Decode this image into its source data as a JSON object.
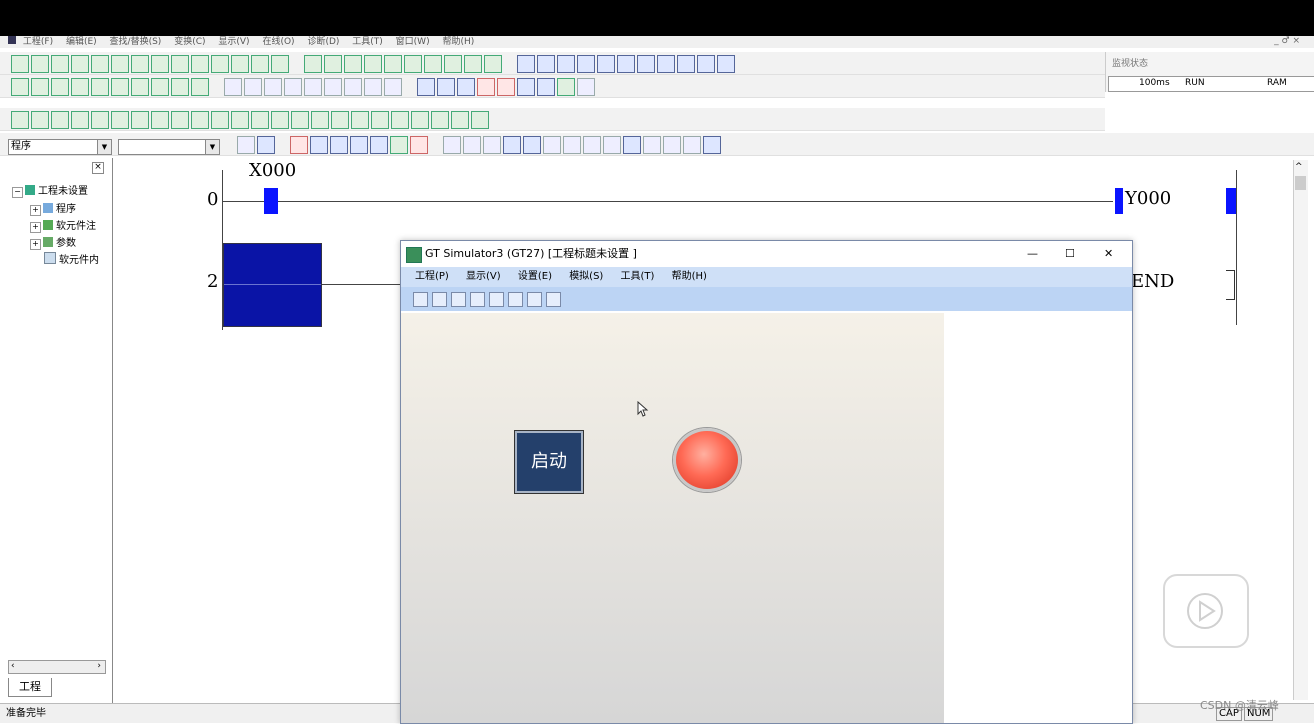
{
  "menubar": {
    "items": [
      "工程(F)",
      "编辑(E)",
      "查找/替换(S)",
      "变换(C)",
      "显示(V)",
      "在线(O)",
      "诊断(D)",
      "工具(T)",
      "窗口(W)",
      "帮助(H)"
    ],
    "window_controls": "_ ♂ ×"
  },
  "monitor": {
    "title": "监视状态",
    "scan_time": "100ms",
    "mode": "RUN",
    "memory": "RAM"
  },
  "toolbar": {
    "program_combo": "程序"
  },
  "tree": {
    "root": "工程未设置",
    "items": [
      "程序",
      "软元件注",
      "参数",
      "软元件内"
    ],
    "tab": "工程"
  },
  "ladder": {
    "step0": "0",
    "step2": "2",
    "contact": "X000",
    "coil": "Y000",
    "end": "END"
  },
  "status": {
    "left": "准备完毕",
    "cap": "CAP",
    "num": "NUM"
  },
  "simulator": {
    "title": "GT Simulator3 (GT27)  [工程标题未设置 ]",
    "menu": [
      "工程(P)",
      "显示(V)",
      "设置(E)",
      "模拟(S)",
      "工具(T)",
      "帮助(H)"
    ],
    "start_button": "启动",
    "minimize": "—",
    "maximize": "☐",
    "close": "✕"
  },
  "watermark": "CSDN @清云峰",
  "colors": {
    "selection": "#0a14a6",
    "lamp": "#ff6a55",
    "button_bg": "#24406b"
  }
}
